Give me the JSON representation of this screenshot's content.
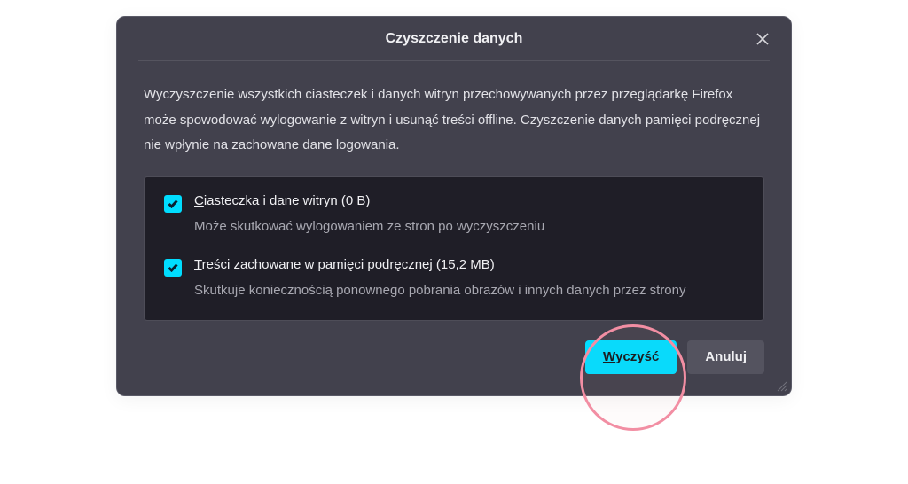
{
  "dialog": {
    "title": "Czyszczenie danych",
    "description": "Wyczyszczenie wszystkich ciasteczek i danych witryn przechowywanych przez przeglądarkę Firefox może spowodować wylogowanie z witryn i usunąć treści offline. Czyszczenie danych pamięci podręcznej nie wpłynie na zachowane dane logowania."
  },
  "options": [
    {
      "checked": true,
      "accel": "C",
      "label_rest": "iasteczka i dane witryn (0 B)",
      "sub": "Może skutkować wylogowaniem ze stron po wyczyszczeniu"
    },
    {
      "checked": true,
      "accel": "T",
      "label_rest": "reści zachowane w pamięci podręcznej (15,2 MB)",
      "sub": "Skutkuje koniecznością ponownego pobrania obrazów i innych danych przez strony"
    }
  ],
  "buttons": {
    "primary_accel": "W",
    "primary_rest": "yczyść",
    "secondary": "Anuluj"
  }
}
